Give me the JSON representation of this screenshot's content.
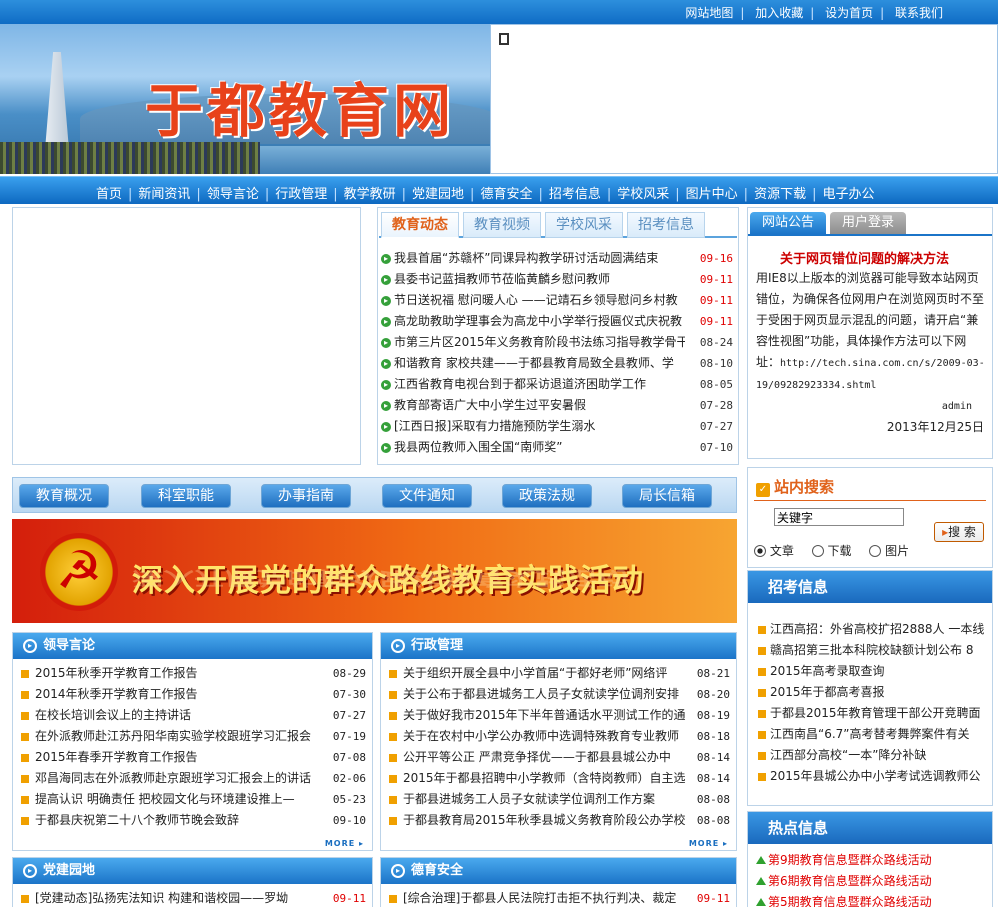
{
  "top_links": [
    "网站地图",
    "加入收藏",
    "设为首页",
    "联系我们"
  ],
  "site_title": "于都教育网",
  "nav": [
    "首页",
    "新闻资讯",
    "领导言论",
    "行政管理",
    "教学教研",
    "党建园地",
    "德育安全",
    "招考信息",
    "学校风采",
    "图片中心",
    "资源下载",
    "电子办公"
  ],
  "main_tabs": [
    "教育动态",
    "教育视频",
    "学校风采",
    "招考信息"
  ],
  "news": [
    {
      "title": "我县首届“苏赣杯”同课异构教学研讨活动圆满结束",
      "date": "09-16",
      "hot": true
    },
    {
      "title": "县委书记蓝揖教师节莅临黄麟乡慰问教师",
      "date": "09-11",
      "hot": true
    },
    {
      "title": "节日送祝福  慰问暖人心  ——记靖石乡领导慰问乡村教",
      "date": "09-11",
      "hot": true
    },
    {
      "title": "高龙助教助学理事会为高龙中小学举行授匾仪式庆祝教",
      "date": "09-11",
      "hot": true
    },
    {
      "title": "市第三片区2015年义务教育阶段书法练习指导教学骨干",
      "date": "08-24",
      "hot": false
    },
    {
      "title": "和谐教育  家校共建——于都县教育局致全县教师、学",
      "date": "08-10",
      "hot": false
    },
    {
      "title": "江西省教育电视台到于都采访退道济困助学工作",
      "date": "08-05",
      "hot": false
    },
    {
      "title": "教育部寄语广大中小学生过平安暑假",
      "date": "07-28",
      "hot": false
    },
    {
      "title": "[江西日报]采取有力措施预防学生溺水",
      "date": "07-27",
      "hot": false
    },
    {
      "title": "我县两位教师入围全国“南师奖”",
      "date": "07-10",
      "hot": false
    }
  ],
  "side_tabs": [
    "网站公告",
    "用户登录"
  ],
  "notice": {
    "title": "关于网页错位问题的解决方法",
    "body": "用IE8以上版本的浏览器可能导致本站网页错位，为确保各位网用户在浏览网页时不至于受困于网页显示混乱的问题，请开启“兼容性视图”功能，具体操作方法可以下网址：",
    "url": "http://tech.sina.com.cn/s/2009-03-19/09282923334.shtml",
    "author": "admin",
    "date": "2013年12月25日"
  },
  "shortcuts": [
    "教育概况",
    "科室职能",
    "办事指南",
    "文件通知",
    "政策法规",
    "局长信箱"
  ],
  "banner_slogan": "深入开展党的群众路线教育实践活动",
  "search": {
    "title": "站内搜索",
    "placeholder": "关键字",
    "button": "搜 索",
    "options": [
      "文章",
      "下载",
      "图片"
    ]
  },
  "panel_leader": {
    "title": "领导言论",
    "more": "MORE ▸",
    "items": [
      {
        "title": "2015年秋季开学教育工作报告",
        "date": "08-29"
      },
      {
        "title": "2014年秋季开学教育工作报告",
        "date": "07-30"
      },
      {
        "title": "在校长培训会议上的主持讲话",
        "date": "07-27"
      },
      {
        "title": "在外派教师赴江苏丹阳华南实验学校跟班学习汇报会",
        "date": "07-19"
      },
      {
        "title": "2015年春季开学教育工作报告",
        "date": "07-08"
      },
      {
        "title": "邓昌海同志在外派教师赴京跟班学习汇报会上的讲话",
        "date": "02-06"
      },
      {
        "title": "提高认识  明确责任  把校园文化与环境建设推上—",
        "date": "05-23"
      },
      {
        "title": "于都县庆祝第二十八个教师节晚会致辞",
        "date": "09-10"
      }
    ]
  },
  "panel_admin": {
    "title": "行政管理",
    "more": "MORE ▸",
    "items": [
      {
        "title": "关于组织开展全县中小学首届“于都好老师”网络评",
        "date": "08-21"
      },
      {
        "title": "关于公布于都县进城务工人员子女就读学位调剂安排",
        "date": "08-20"
      },
      {
        "title": "关于做好我市2015年下半年普通话水平测试工作的通",
        "date": "08-19"
      },
      {
        "title": "关于在农村中小学公办教师中选调特殊教育专业教师",
        "date": "08-18"
      },
      {
        "title": "公开平等公正  严肃竞争择优——于都县县城公办中",
        "date": "08-14"
      },
      {
        "title": "2015年于都县招聘中小学教师（含特岗教师）自主选",
        "date": "08-14"
      },
      {
        "title": "于都县进城务工人员子女就读学位调剂工作方案",
        "date": "08-08"
      },
      {
        "title": "于都县教育局2015年秋季县城义务教育阶段公办学校",
        "date": "08-08"
      }
    ]
  },
  "panel_party": {
    "title": "党建园地",
    "items": [
      {
        "title": "[党建动态]弘扬宪法知识  构建和谐校园——罗坳",
        "date": "09-11"
      }
    ]
  },
  "panel_moral": {
    "title": "德育安全",
    "items": [
      {
        "title": "[综合治理]于都县人民法院打击拒不执行判决、裁定",
        "date": "09-11"
      }
    ]
  },
  "exam_info": {
    "title": "招考信息",
    "items": [
      "江西高招：外省高校扩招2888人 一本线",
      "赣高招第三批本科院校缺额计划公布 8",
      "2015年高考录取查询",
      "2015年于都高考喜报",
      "于都县2015年教育管理干部公开竞聘面",
      "江西南昌“6.7”高考替考舞弊案件有关",
      "江西部分高校“一本”降分补缺",
      "2015年县城公办中小学考试选调教师公"
    ]
  },
  "hot_info": {
    "title": "热点信息",
    "items": [
      "第9期教育信息暨群众路线活动",
      "第6期教育信息暨群众路线活动",
      "第5期教育信息暨群众路线活动"
    ]
  },
  "colors": {
    "brand_blue": "#1a6fc4",
    "hot_red": "#e00000",
    "accent_orange": "#e0621b"
  }
}
